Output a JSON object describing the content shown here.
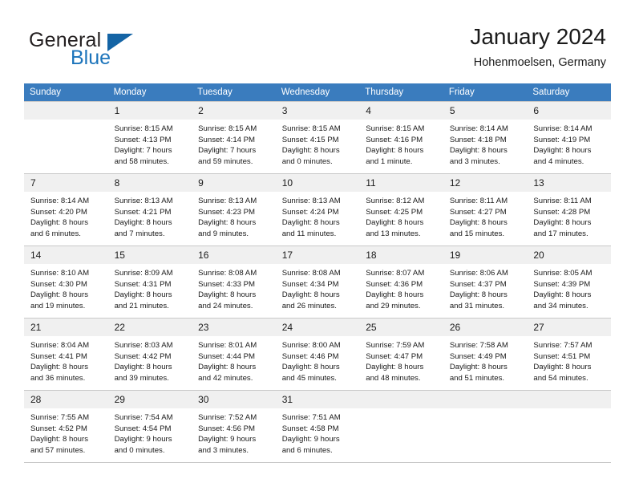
{
  "brand": {
    "name_part1": "General",
    "name_part2": "Blue",
    "flag_icon": "triangle-flag-icon",
    "accent_color": "#1464a5"
  },
  "header": {
    "title": "January 2024",
    "subtitle": "Hohenmoelsen, Germany"
  },
  "calendar": {
    "header_color": "#3a7cbe",
    "weekdays": [
      "Sunday",
      "Monday",
      "Tuesday",
      "Wednesday",
      "Thursday",
      "Friday",
      "Saturday"
    ],
    "weeks": [
      [
        {
          "day": "",
          "lines": []
        },
        {
          "day": "1",
          "lines": [
            "Sunrise: 8:15 AM",
            "Sunset: 4:13 PM",
            "Daylight: 7 hours",
            "and 58 minutes."
          ]
        },
        {
          "day": "2",
          "lines": [
            "Sunrise: 8:15 AM",
            "Sunset: 4:14 PM",
            "Daylight: 7 hours",
            "and 59 minutes."
          ]
        },
        {
          "day": "3",
          "lines": [
            "Sunrise: 8:15 AM",
            "Sunset: 4:15 PM",
            "Daylight: 8 hours",
            "and 0 minutes."
          ]
        },
        {
          "day": "4",
          "lines": [
            "Sunrise: 8:15 AM",
            "Sunset: 4:16 PM",
            "Daylight: 8 hours",
            "and 1 minute."
          ]
        },
        {
          "day": "5",
          "lines": [
            "Sunrise: 8:14 AM",
            "Sunset: 4:18 PM",
            "Daylight: 8 hours",
            "and 3 minutes."
          ]
        },
        {
          "day": "6",
          "lines": [
            "Sunrise: 8:14 AM",
            "Sunset: 4:19 PM",
            "Daylight: 8 hours",
            "and 4 minutes."
          ]
        }
      ],
      [
        {
          "day": "7",
          "lines": [
            "Sunrise: 8:14 AM",
            "Sunset: 4:20 PM",
            "Daylight: 8 hours",
            "and 6 minutes."
          ]
        },
        {
          "day": "8",
          "lines": [
            "Sunrise: 8:13 AM",
            "Sunset: 4:21 PM",
            "Daylight: 8 hours",
            "and 7 minutes."
          ]
        },
        {
          "day": "9",
          "lines": [
            "Sunrise: 8:13 AM",
            "Sunset: 4:23 PM",
            "Daylight: 8 hours",
            "and 9 minutes."
          ]
        },
        {
          "day": "10",
          "lines": [
            "Sunrise: 8:13 AM",
            "Sunset: 4:24 PM",
            "Daylight: 8 hours",
            "and 11 minutes."
          ]
        },
        {
          "day": "11",
          "lines": [
            "Sunrise: 8:12 AM",
            "Sunset: 4:25 PM",
            "Daylight: 8 hours",
            "and 13 minutes."
          ]
        },
        {
          "day": "12",
          "lines": [
            "Sunrise: 8:11 AM",
            "Sunset: 4:27 PM",
            "Daylight: 8 hours",
            "and 15 minutes."
          ]
        },
        {
          "day": "13",
          "lines": [
            "Sunrise: 8:11 AM",
            "Sunset: 4:28 PM",
            "Daylight: 8 hours",
            "and 17 minutes."
          ]
        }
      ],
      [
        {
          "day": "14",
          "lines": [
            "Sunrise: 8:10 AM",
            "Sunset: 4:30 PM",
            "Daylight: 8 hours",
            "and 19 minutes."
          ]
        },
        {
          "day": "15",
          "lines": [
            "Sunrise: 8:09 AM",
            "Sunset: 4:31 PM",
            "Daylight: 8 hours",
            "and 21 minutes."
          ]
        },
        {
          "day": "16",
          "lines": [
            "Sunrise: 8:08 AM",
            "Sunset: 4:33 PM",
            "Daylight: 8 hours",
            "and 24 minutes."
          ]
        },
        {
          "day": "17",
          "lines": [
            "Sunrise: 8:08 AM",
            "Sunset: 4:34 PM",
            "Daylight: 8 hours",
            "and 26 minutes."
          ]
        },
        {
          "day": "18",
          "lines": [
            "Sunrise: 8:07 AM",
            "Sunset: 4:36 PM",
            "Daylight: 8 hours",
            "and 29 minutes."
          ]
        },
        {
          "day": "19",
          "lines": [
            "Sunrise: 8:06 AM",
            "Sunset: 4:37 PM",
            "Daylight: 8 hours",
            "and 31 minutes."
          ]
        },
        {
          "day": "20",
          "lines": [
            "Sunrise: 8:05 AM",
            "Sunset: 4:39 PM",
            "Daylight: 8 hours",
            "and 34 minutes."
          ]
        }
      ],
      [
        {
          "day": "21",
          "lines": [
            "Sunrise: 8:04 AM",
            "Sunset: 4:41 PM",
            "Daylight: 8 hours",
            "and 36 minutes."
          ]
        },
        {
          "day": "22",
          "lines": [
            "Sunrise: 8:03 AM",
            "Sunset: 4:42 PM",
            "Daylight: 8 hours",
            "and 39 minutes."
          ]
        },
        {
          "day": "23",
          "lines": [
            "Sunrise: 8:01 AM",
            "Sunset: 4:44 PM",
            "Daylight: 8 hours",
            "and 42 minutes."
          ]
        },
        {
          "day": "24",
          "lines": [
            "Sunrise: 8:00 AM",
            "Sunset: 4:46 PM",
            "Daylight: 8 hours",
            "and 45 minutes."
          ]
        },
        {
          "day": "25",
          "lines": [
            "Sunrise: 7:59 AM",
            "Sunset: 4:47 PM",
            "Daylight: 8 hours",
            "and 48 minutes."
          ]
        },
        {
          "day": "26",
          "lines": [
            "Sunrise: 7:58 AM",
            "Sunset: 4:49 PM",
            "Daylight: 8 hours",
            "and 51 minutes."
          ]
        },
        {
          "day": "27",
          "lines": [
            "Sunrise: 7:57 AM",
            "Sunset: 4:51 PM",
            "Daylight: 8 hours",
            "and 54 minutes."
          ]
        }
      ],
      [
        {
          "day": "28",
          "lines": [
            "Sunrise: 7:55 AM",
            "Sunset: 4:52 PM",
            "Daylight: 8 hours",
            "and 57 minutes."
          ]
        },
        {
          "day": "29",
          "lines": [
            "Sunrise: 7:54 AM",
            "Sunset: 4:54 PM",
            "Daylight: 9 hours",
            "and 0 minutes."
          ]
        },
        {
          "day": "30",
          "lines": [
            "Sunrise: 7:52 AM",
            "Sunset: 4:56 PM",
            "Daylight: 9 hours",
            "and 3 minutes."
          ]
        },
        {
          "day": "31",
          "lines": [
            "Sunrise: 7:51 AM",
            "Sunset: 4:58 PM",
            "Daylight: 9 hours",
            "and 6 minutes."
          ]
        },
        {
          "day": "",
          "lines": []
        },
        {
          "day": "",
          "lines": []
        },
        {
          "day": "",
          "lines": []
        }
      ]
    ]
  }
}
